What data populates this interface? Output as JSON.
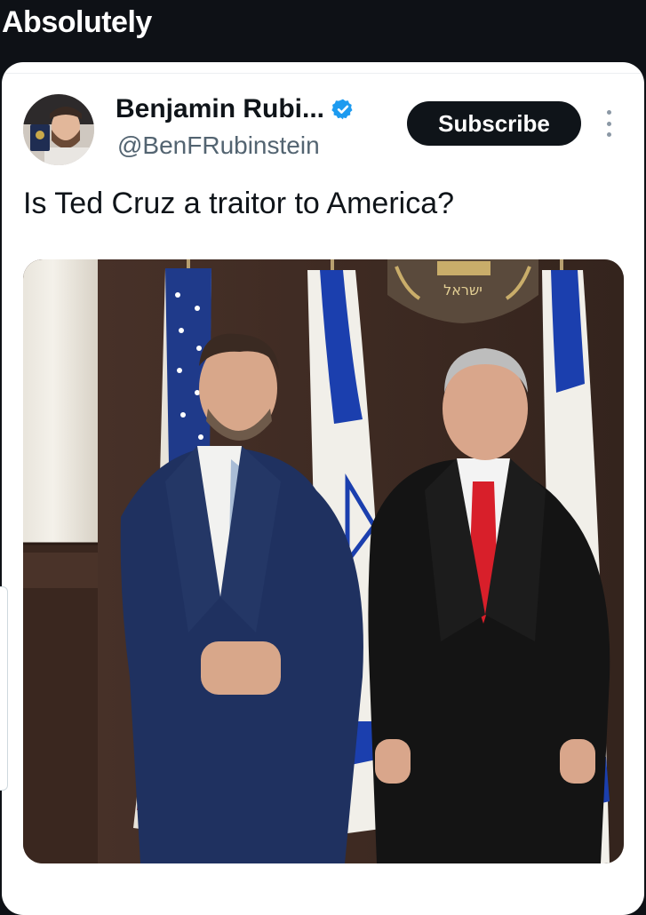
{
  "post_caption": "Absolutely",
  "tweet": {
    "display_name": "Benjamin Rubi...",
    "handle": "@BenFRubinstein",
    "subscribe_label": "Subscribe",
    "text": "Is Ted Cruz a traitor to America?",
    "emblem_text": "ישראל"
  },
  "colors": {
    "background_dark": "#0e1116",
    "card": "#ffffff",
    "button": "#0f1419",
    "verified": "#1d9bf0",
    "handle": "#536471"
  },
  "icons": {
    "verified": "verified-badge-icon",
    "more": "more-vertical-icon"
  }
}
